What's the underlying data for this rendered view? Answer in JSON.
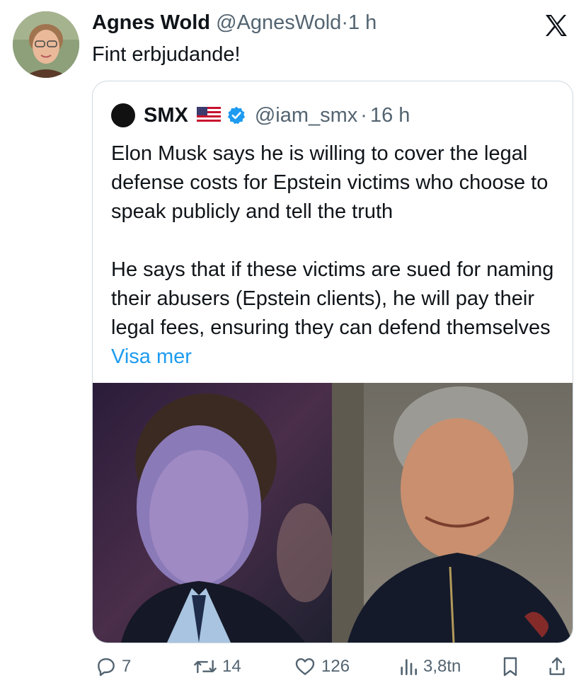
{
  "tweet": {
    "author_name": "Agnes Wold",
    "author_handle": "@AgnesWold",
    "separator": "·",
    "time": "1 h",
    "text": "Fint erbjudande!"
  },
  "quoted": {
    "author_name": "SMX",
    "author_handle": "@iam_smx",
    "separator": "·",
    "time": "16 h",
    "paragraph1": "Elon Musk says he is willing to cover the legal defense costs for Epstein victims who choose to speak publicly and tell the truth",
    "paragraph2": "He says that if these victims are sued for naming their abusers (Epstein clients), he will pay their legal fees, ensuring they can defend themselves",
    "show_more": "Visa mer"
  },
  "actions": {
    "replies": "7",
    "reposts": "14",
    "likes": "126",
    "views": "3,8tn"
  },
  "icons": [
    "x-logo-icon",
    "verified-badge-icon",
    "us-flag-icon",
    "reply-icon",
    "repost-icon",
    "like-icon",
    "views-icon",
    "bookmark-icon",
    "share-icon"
  ],
  "colors": {
    "link": "#1d9bf0",
    "muted": "#536471",
    "text": "#0f1419",
    "border": "#cfd9de"
  }
}
